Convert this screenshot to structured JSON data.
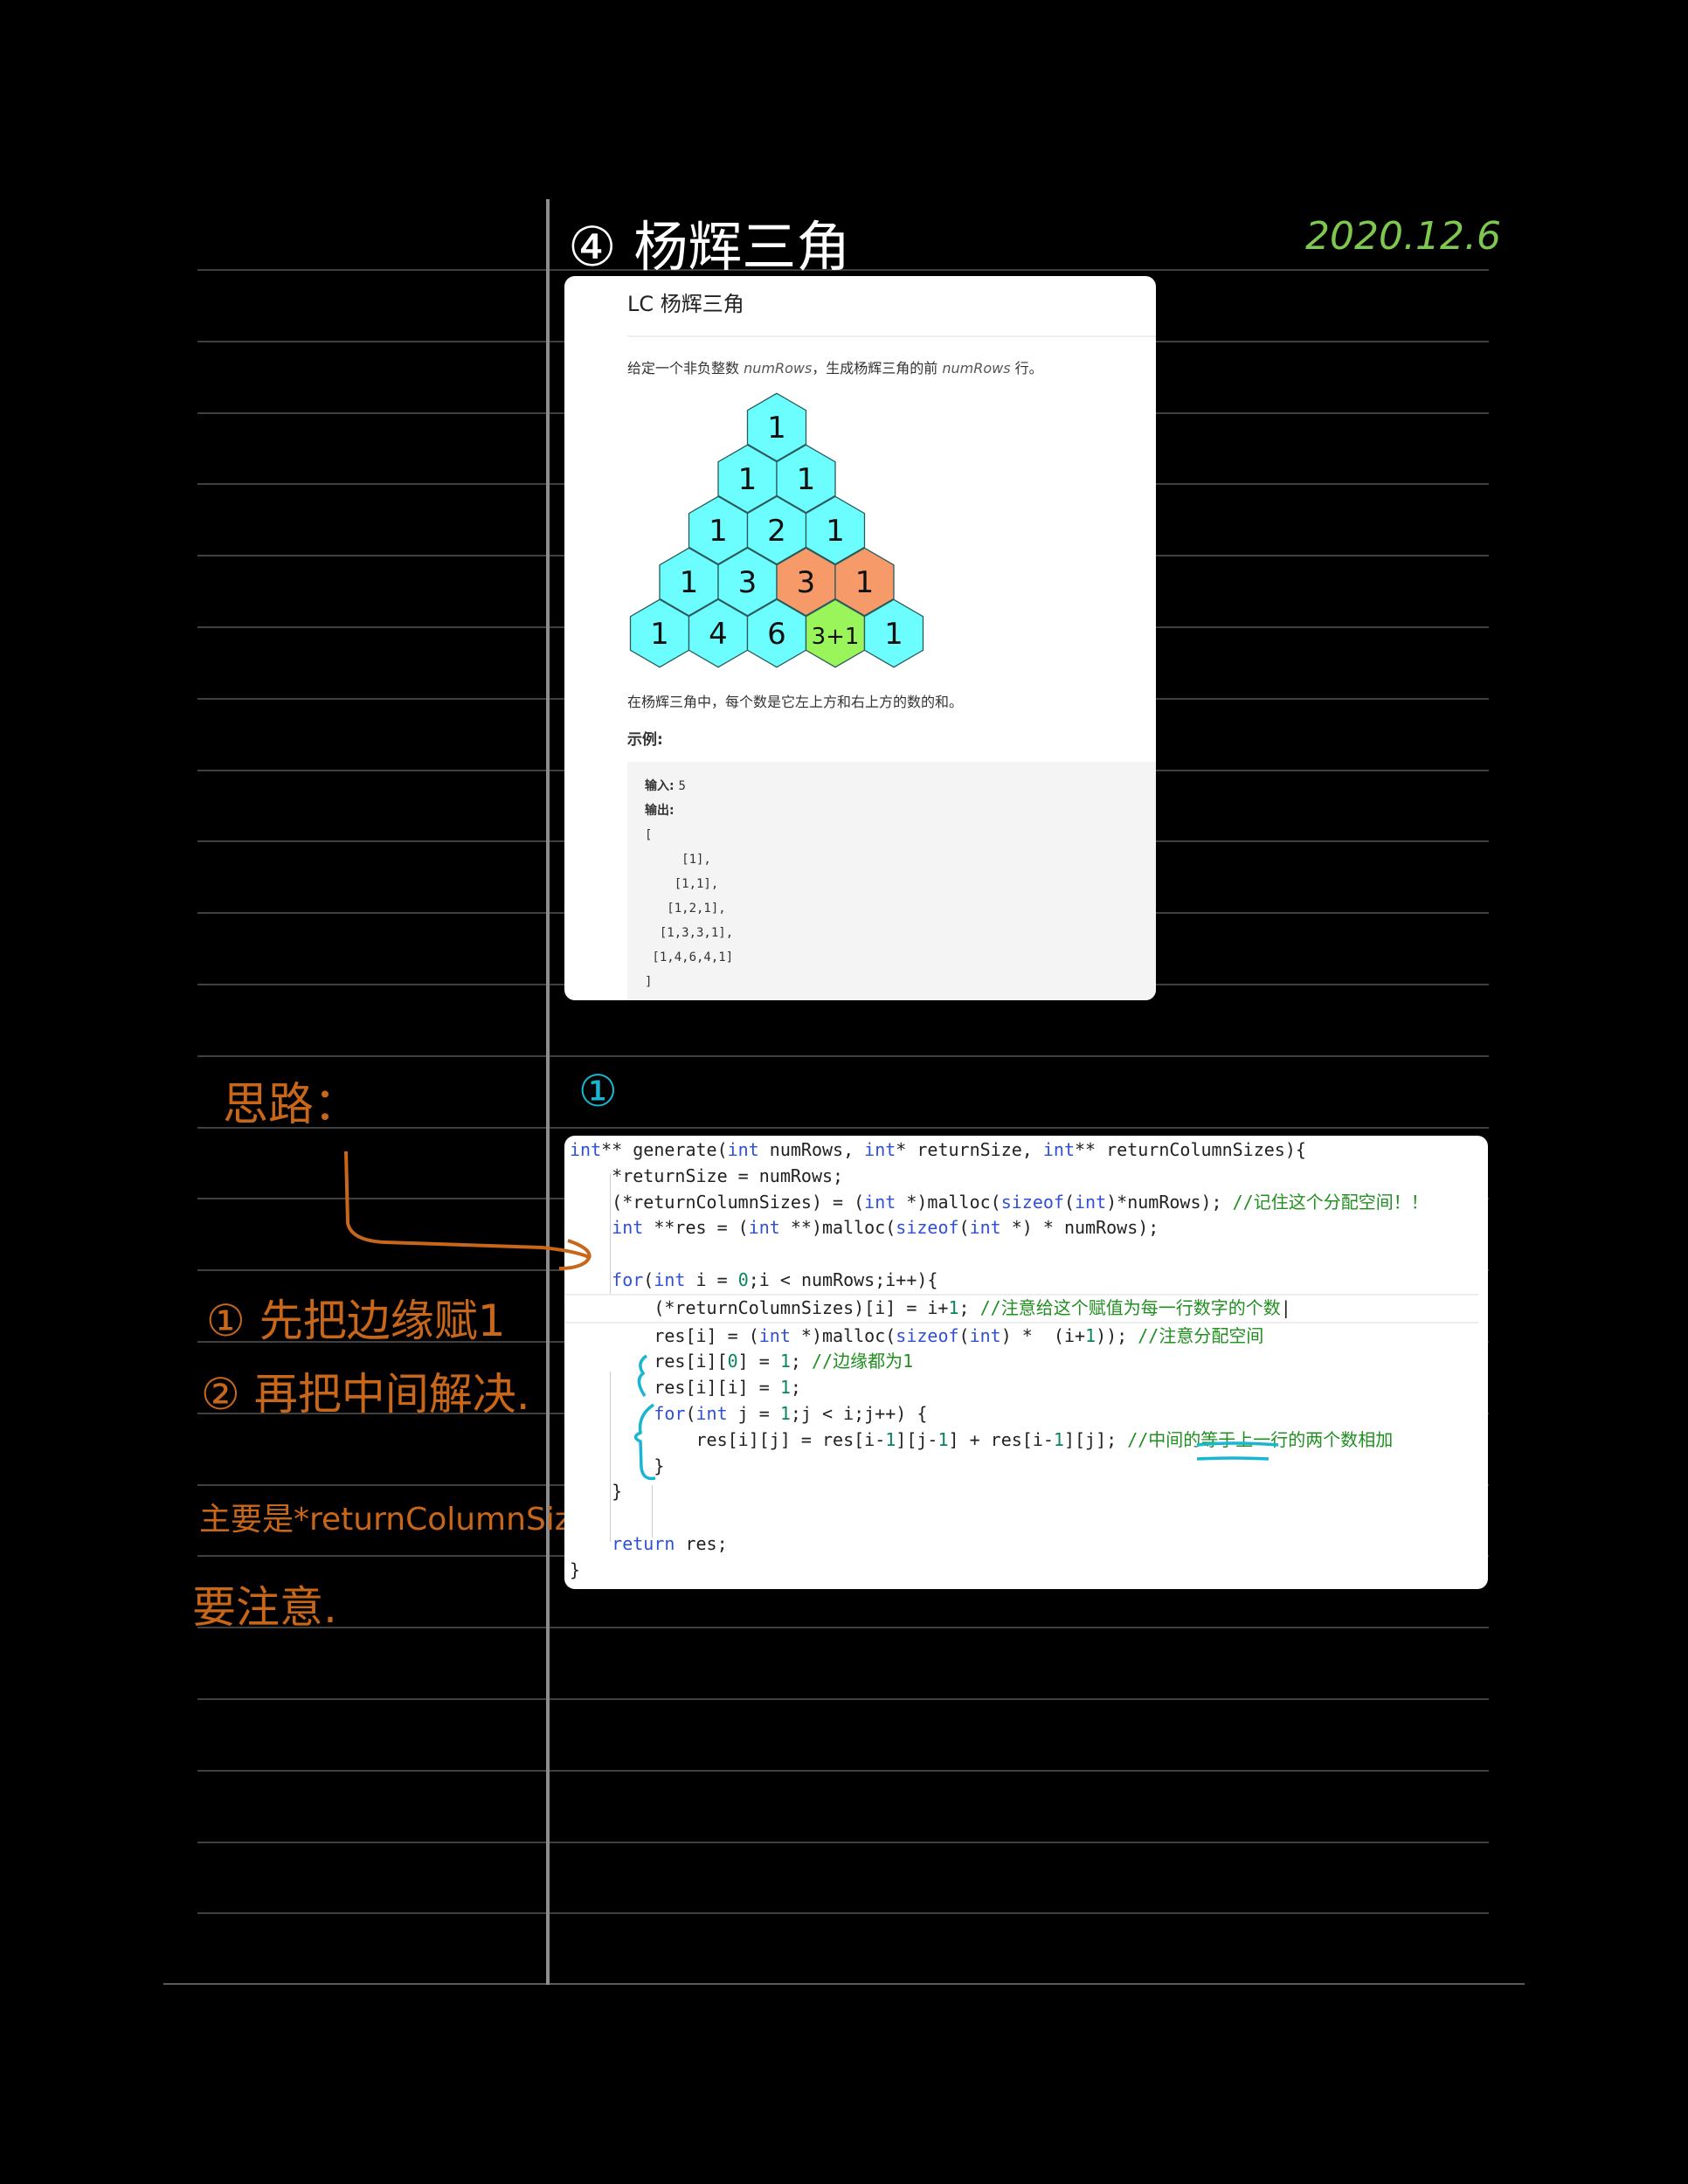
{
  "header": {
    "title": "④ 杨辉三角",
    "date": "2020.12.6"
  },
  "problem": {
    "title": "LC  杨辉三角",
    "desc_prefix": "给定一个非负整数 ",
    "desc_var1": "numRows",
    "desc_mid": "，生成杨辉三角的前 ",
    "desc_var2": "numRows",
    "desc_suffix": " 行。",
    "caption": "在杨辉三角中，每个数是它左上方和右上方的数的和。",
    "example_label": "示例:",
    "input_label": "输入: ",
    "input_value": "5",
    "output_label": "输出:",
    "output_lines": [
      "[",
      "     [1],",
      "    [1,1],",
      "   [1,2,1],",
      "  [1,3,3,1],",
      " [1,4,6,4,1]",
      "]"
    ],
    "triangle": [
      [
        {
          "v": "1",
          "c": "cyan"
        }
      ],
      [
        {
          "v": "1",
          "c": "cyan"
        },
        {
          "v": "1",
          "c": "cyan"
        }
      ],
      [
        {
          "v": "1",
          "c": "cyan"
        },
        {
          "v": "2",
          "c": "cyan"
        },
        {
          "v": "1",
          "c": "cyan"
        }
      ],
      [
        {
          "v": "1",
          "c": "cyan"
        },
        {
          "v": "3",
          "c": "cyan"
        },
        {
          "v": "3",
          "c": "orange"
        },
        {
          "v": "1",
          "c": "orange"
        }
      ],
      [
        {
          "v": "1",
          "c": "cyan"
        },
        {
          "v": "4",
          "c": "cyan"
        },
        {
          "v": "6",
          "c": "cyan"
        },
        {
          "v": "3+1",
          "c": "green"
        },
        {
          "v": "1",
          "c": "cyan"
        }
      ]
    ],
    "colors": {
      "cyan": "#6cfefe",
      "orange": "#f79a6a",
      "green": "#99f55a"
    }
  },
  "section_marker": "①",
  "notes": {
    "heading": "思路：",
    "step1": "① 先把边缘赋1",
    "step2": "② 再把中间解决.",
    "remark1": "主要是*returnColumnSize",
    "remark2": "要注意."
  },
  "code": {
    "c1": "//记住这个分配空间！！",
    "c2": "//注意给这个赋值为每一行数字的个数",
    "c3": "//注意分配空间",
    "c4": "//边缘都为1",
    "c5": "//中间的等于上一行的两个数相加"
  },
  "colors": {
    "ink_orange": "#c8671a",
    "ink_cyan": "#19b6d2",
    "ink_green": "#7ec850"
  }
}
